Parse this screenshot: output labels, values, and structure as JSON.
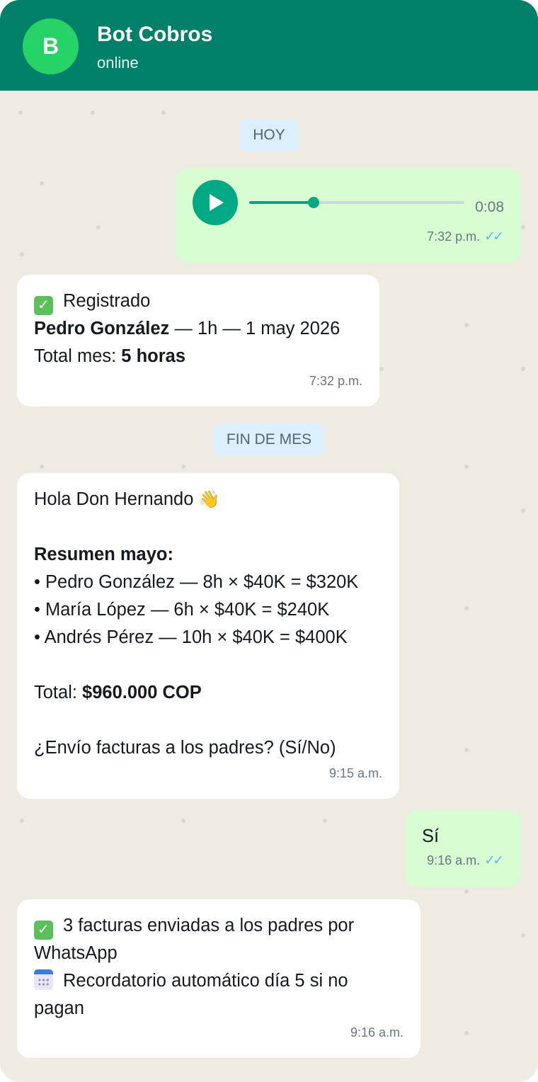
{
  "header": {
    "avatar_letter": "B",
    "title": "Bot Cobros",
    "status": "online"
  },
  "separators": {
    "today": "HOY",
    "month_end": "FIN DE MES"
  },
  "voice_note": {
    "duration": "0:08",
    "progress": 0.3,
    "time": "7:32 p.m.",
    "read_ticks": "✓✓"
  },
  "registered": {
    "title": "Registrado",
    "name": "Pedro González",
    "detail": " — 1h — 1 may 2026",
    "total_label": "Total mes: ",
    "total_value": "5 horas",
    "time": "7:32 p.m."
  },
  "summary": {
    "greeting": "Hola Don Hernando",
    "heading": "Resumen mayo:",
    "items": [
      "• Pedro González — 8h × $40K = $320K",
      "• María López — 6h × $40K = $240K",
      "• Andrés Pérez — 10h × $40K = $400K"
    ],
    "total_label": "Total: ",
    "total_value": "$960.000 COP",
    "question": "¿Envío facturas a los padres? (Sí/No)",
    "time": "9:15 a.m."
  },
  "reply": {
    "text": "Sí",
    "time": "9:16 a.m.",
    "read_ticks": "✓✓"
  },
  "confirmation": {
    "line1a": "3 facturas enviadas a los padres por",
    "line1b": "WhatsApp",
    "line2a": "Recordatorio automático día 5 si no",
    "line2b": "pagan",
    "time": "9:16 a.m."
  },
  "icons": {
    "check": "check-mark-button-icon",
    "calendar": "calendar-icon",
    "wave": "waving-hand-icon",
    "play": "play-icon"
  },
  "colors": {
    "header": "#008069",
    "avatar": "#25d366",
    "background": "#efeae2",
    "outgoing": "#d9fdd3",
    "incoming": "#ffffff",
    "accent": "#00a884",
    "ticks": "#53bdeb",
    "separator": "#dcefff"
  }
}
